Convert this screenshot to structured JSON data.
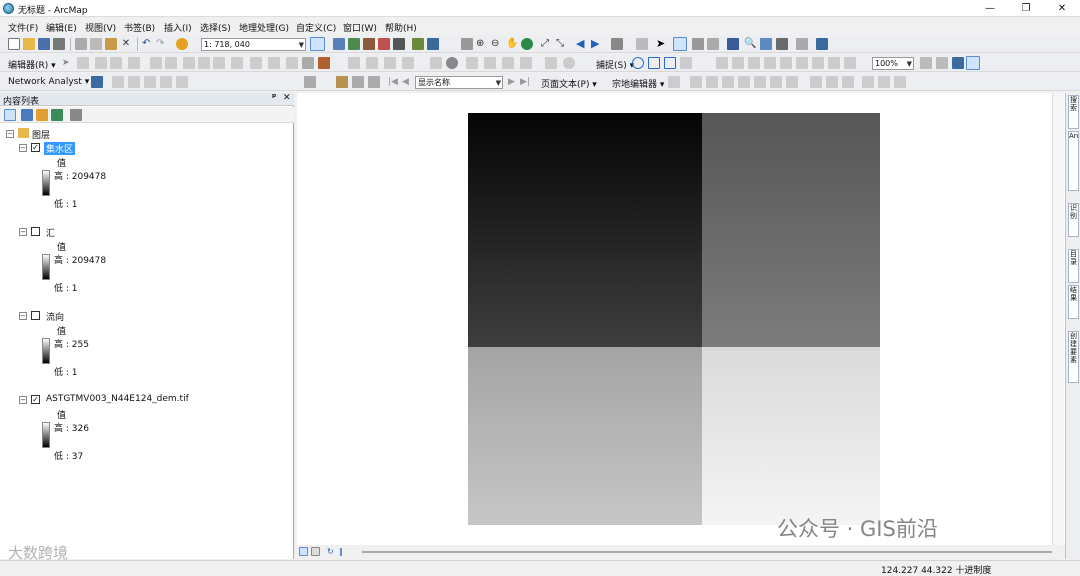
{
  "window": {
    "title": "无标题 - ArcMap",
    "minimize": "—",
    "maximize": "❐",
    "close": "✕"
  },
  "menu": [
    "文件(F)",
    "编辑(E)",
    "视图(V)",
    "书签(B)",
    "插入(I)",
    "选择(S)",
    "地理处理(G)",
    "自定义(C)",
    "窗口(W)",
    "帮助(H)"
  ],
  "toolbar": {
    "scale_value": "1: 718, 040",
    "editor_label": "编辑器(R) ▾",
    "network_analyst": "Network Analyst ▾",
    "snapping_label": "捕捉(S) ▾",
    "display_name_dropdown": "显示名称",
    "page_text": "页面文本(P) ▾",
    "georef_editor": "宗地编辑器 ▾",
    "zoom_percent": "100%"
  },
  "toc": {
    "title": "内容列表",
    "pin": "ᵖ",
    "close": "✕",
    "root": "图层",
    "layers": [
      {
        "name": "集水区",
        "checked": true,
        "selected": true,
        "value_label": "值",
        "high": "高 : 209478",
        "low": "低 : 1"
      },
      {
        "name": "汇",
        "checked": false,
        "selected": false,
        "value_label": "值",
        "high": "高 : 209478",
        "low": "低 : 1"
      },
      {
        "name": "流向",
        "checked": false,
        "selected": false,
        "value_label": "值",
        "high": "高 : 255",
        "low": "低 : 1"
      },
      {
        "name": "ASTGTMV003_N44E124_dem.tif",
        "checked": true,
        "selected": false,
        "value_label": "值",
        "high": "高 : 326",
        "low": "低 : 37"
      }
    ]
  },
  "map": {
    "quadrant_gradients": [
      {
        "from": "#050505",
        "to": "#3e3e3e"
      },
      {
        "from": "#565656",
        "to": "#7c7c7c"
      },
      {
        "from": "#a4a4a4",
        "to": "#c6c6c6"
      },
      {
        "from": "#dadada",
        "to": "#f4f4f4"
      }
    ]
  },
  "status": {
    "coords": "124.227  44.322 十进制度"
  },
  "right_tabs": [
    "搜索",
    "ArcToolbox",
    "识别",
    "目录",
    "结果",
    "创建要素"
  ],
  "watermarks": {
    "top": "公众号 · GIS前沿",
    "bottom": "大数跨境"
  },
  "colors": {
    "selection": "#3399ff",
    "toc_header": "#e4e8ef"
  }
}
